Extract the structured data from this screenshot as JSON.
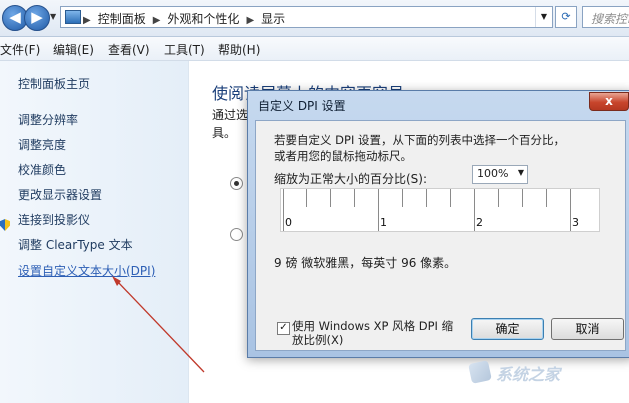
{
  "window": {
    "breadcrumb": [
      "控制面板",
      "外观和个性化",
      "显示"
    ],
    "search_placeholder": "搜索控制"
  },
  "menubar": {
    "items": [
      "文件(F)",
      "编辑(E)",
      "查看(V)",
      "工具(T)",
      "帮助(H)"
    ]
  },
  "sidebar": {
    "items": [
      "控制面板主页",
      "调整分辨率",
      "调整亮度",
      "校准颜色",
      "更改显示器设置",
      "连接到投影仪",
      "调整 ClearType 文本",
      "设置自定义文本大小(DPI)"
    ]
  },
  "main": {
    "title": "使阅读屏幕上的内容更容易",
    "subtitle": "通过选",
    "subtitle2": "具。"
  },
  "dialog": {
    "title": "自定义 DPI 设置",
    "close": "x",
    "instruction_line1": "若要自定义 DPI 设置，从下面的列表中选择一个百分比，",
    "instruction_line2": "或者用您的鼠标拖动标尺。",
    "scale_label": "缩放为正常大小的百分比(S):",
    "scale_value": "100%",
    "ruler_labels": [
      "0",
      "1",
      "2",
      "3"
    ],
    "font_info": "9 磅 微软雅黑，每英寸 96 像素。",
    "checkbox_label": "使用 Windows XP 风格 DPI 缩放比例(X)",
    "checkbox_checked": true,
    "ok_label": "确定",
    "cancel_label": "取消"
  },
  "watermark": {
    "text": "系统之家"
  }
}
